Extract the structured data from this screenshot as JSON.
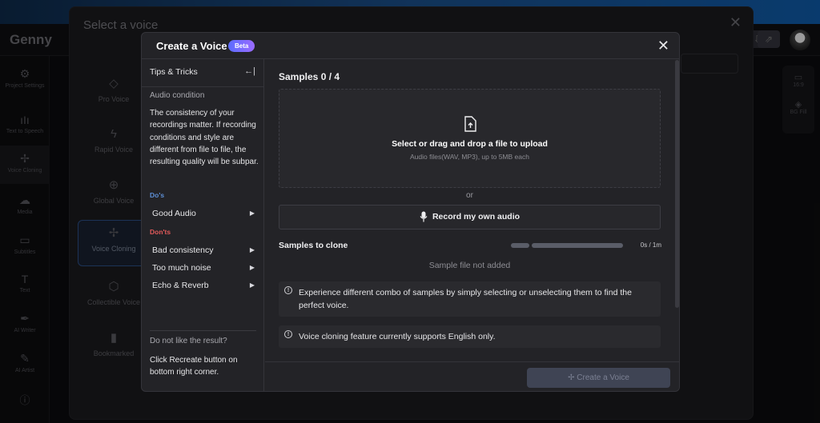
{
  "app": {
    "logo": "Genny",
    "nav": [
      {
        "label": "Project Settings",
        "icon": "gear-icon"
      },
      {
        "label": "Text to Speech",
        "icon": "waveform-icon"
      },
      {
        "label": "Voice Cloning",
        "icon": "sparkle-icon"
      },
      {
        "label": "Media",
        "icon": "cloud-upload-icon"
      },
      {
        "label": "Subtitles",
        "icon": "subtitles-icon"
      },
      {
        "label": "Text",
        "icon": "text-icon"
      },
      {
        "label": "AI Writer",
        "icon": "pen-icon"
      },
      {
        "label": "AI Artist",
        "icon": "brush-icon"
      }
    ],
    "right_panel": [
      {
        "label": "16:9",
        "icon": "aspect-ratio-icon"
      },
      {
        "label": "BG Fill",
        "icon": "fill-icon"
      }
    ]
  },
  "select_voice": {
    "title": "Select a voice",
    "nav": [
      {
        "label": "Pro Voice",
        "icon": "diamond-icon"
      },
      {
        "label": "Rapid Voice",
        "icon": "lightning-icon"
      },
      {
        "label": "Global Voice",
        "icon": "globe-icon"
      },
      {
        "label": "Voice Cloning",
        "icon": "sparkle-icon"
      },
      {
        "label": "Collectible Voice",
        "icon": "cube-icon"
      },
      {
        "label": "Bookmarked",
        "icon": "bookmark-icon"
      }
    ]
  },
  "create_voice": {
    "title": "Create a Voice",
    "badge": "Beta",
    "tips": {
      "header": "Tips & Tricks",
      "sub": "Audio condition",
      "text": "The consistency of your recordings matter. If recording conditions and style are different from file to file, the resulting quality will be subpar.",
      "dos_label": "Do's",
      "dos": [
        "Good Audio"
      ],
      "donts_label": "Don'ts",
      "donts": [
        "Bad consistency",
        "Too much noise",
        "Echo & Reverb"
      ],
      "question": "Do not like the result?",
      "answer": "Click Recreate button on bottom right corner."
    },
    "samples_title": "Samples 0 / 4",
    "dropzone": {
      "main": "Select or drag and drop a file to upload",
      "sub": "Audio files(WAV, MP3), up to 5MB each"
    },
    "or": "or",
    "record_button": "Record my own audio",
    "samples_to_clone": "Samples to clone",
    "duration": "0s / 1m",
    "not_added": "Sample file not added",
    "info1": "Experience different combo of samples by simply selecting or unselecting them to find the perfect voice.",
    "info2": "Voice cloning feature currently supports English only.",
    "create_button": "Create a Voice"
  }
}
